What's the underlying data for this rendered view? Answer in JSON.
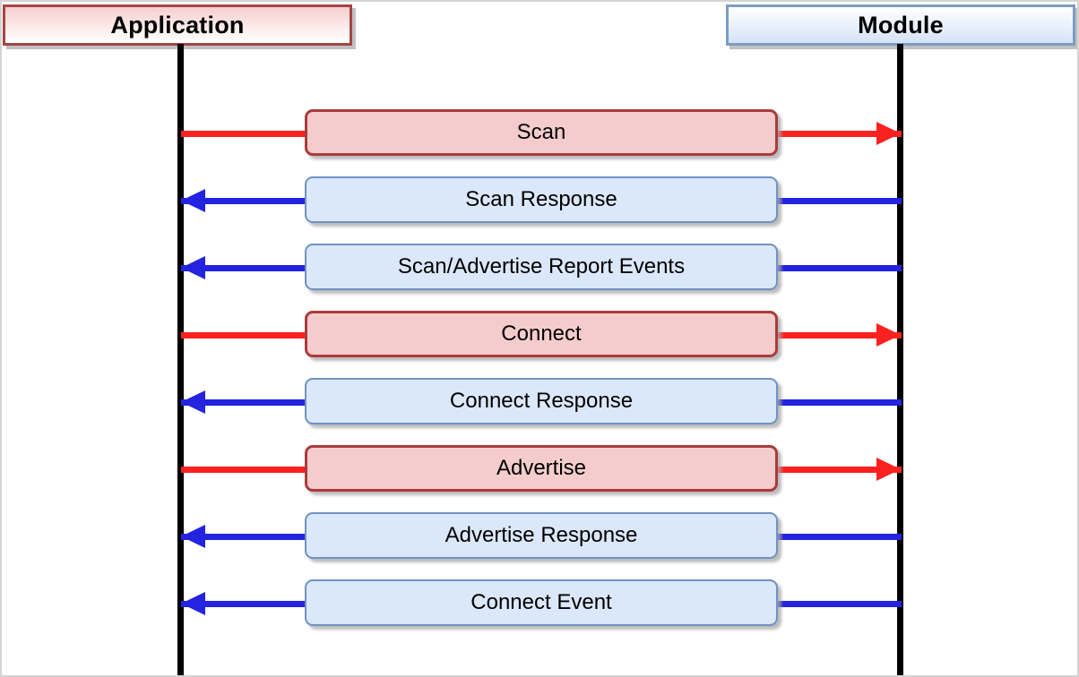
{
  "diagram": {
    "type": "sequence-diagram",
    "actors": [
      {
        "id": "application",
        "label": "Application",
        "side": "left",
        "accent": "#a34545"
      },
      {
        "id": "module",
        "label": "Module",
        "side": "right",
        "accent": "#7d9cc4"
      }
    ],
    "colors": {
      "request_line": "#fb2121",
      "request_box_fill": "#f5cccc",
      "request_box_border": "#aa3b3b",
      "response_line": "#2323e0",
      "response_box_fill": "#dbe7fa",
      "response_box_border": "#6f92c4",
      "lifeline": "#000000",
      "canvas": "#ffffff",
      "frame": "#d4d4d4"
    },
    "messages": [
      {
        "label": "Scan",
        "direction": "right",
        "kind": "request"
      },
      {
        "label": "Scan Response",
        "direction": "left",
        "kind": "response"
      },
      {
        "label": "Scan/Advertise Report Events",
        "direction": "left",
        "kind": "response"
      },
      {
        "label": "Connect",
        "direction": "right",
        "kind": "request"
      },
      {
        "label": "Connect Response",
        "direction": "left",
        "kind": "response"
      },
      {
        "label": "Advertise",
        "direction": "right",
        "kind": "request"
      },
      {
        "label": "Advertise Response",
        "direction": "left",
        "kind": "response"
      },
      {
        "label": "Connect Event",
        "direction": "left",
        "kind": "response"
      }
    ]
  }
}
